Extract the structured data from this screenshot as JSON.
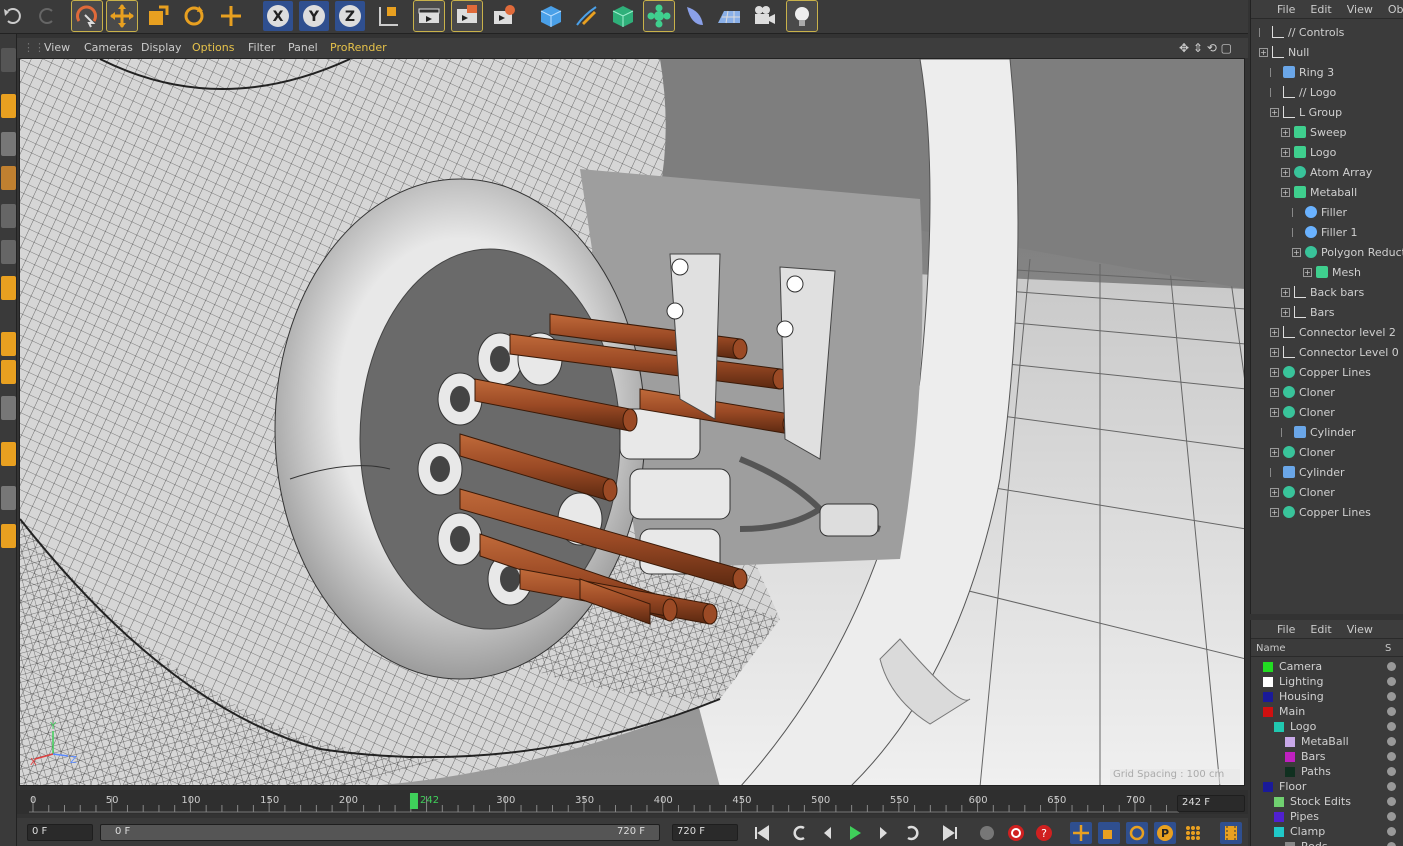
{
  "viewport_menu": [
    "View",
    "Cameras",
    "Display",
    "Options",
    "Filter",
    "Panel",
    "ProRender"
  ],
  "viewport_active_menu": "Options",
  "grid_spacing": "Grid Spacing : 100 cm",
  "axis": {
    "x": "X",
    "y": "Y",
    "z": "Z"
  },
  "toolbar_icons": [
    "undo-icon",
    "redo-icon",
    "live-selection-icon",
    "move-icon",
    "scale-icon",
    "rotate-icon",
    "move-icon",
    "x-axis-icon",
    "y-axis-icon",
    "z-axis-icon",
    "coordinate-system-icon",
    "render-view-icon",
    "render-picture-viewer-icon",
    "render-settings-icon",
    "cube-icon",
    "pen-icon",
    "subdivision-icon",
    "cloner-icon",
    "deformer-icon",
    "floor-icon",
    "camera-icon",
    "light-icon"
  ],
  "axis_labels": [
    "X",
    "Y",
    "Z"
  ],
  "object_panel": {
    "menu": [
      "File",
      "Edit",
      "View",
      "Obje"
    ],
    "items": [
      {
        "label": "// Controls",
        "icon": "null",
        "indent": 0,
        "exp": false
      },
      {
        "label": "Null",
        "icon": "null",
        "indent": 0,
        "exp": true
      },
      {
        "label": "Ring 3",
        "icon": "blue",
        "indent": 1,
        "exp": false
      },
      {
        "label": "// Logo",
        "icon": "null",
        "indent": 1,
        "exp": false
      },
      {
        "label": "L Group",
        "icon": "null",
        "indent": 1,
        "exp": true
      },
      {
        "label": "Sweep",
        "icon": "green",
        "indent": 2,
        "exp": true
      },
      {
        "label": "Logo",
        "icon": "green",
        "indent": 2,
        "exp": true
      },
      {
        "label": "Atom Array",
        "icon": "teal",
        "indent": 2,
        "exp": true
      },
      {
        "label": "Metaball",
        "icon": "green",
        "indent": 2,
        "exp": true
      },
      {
        "label": "Filler",
        "icon": "sphere",
        "indent": 3,
        "exp": false
      },
      {
        "label": "Filler 1",
        "icon": "sphere",
        "indent": 3,
        "exp": false
      },
      {
        "label": "Polygon Reducti",
        "icon": "teal",
        "indent": 3,
        "exp": true
      },
      {
        "label": "Mesh",
        "icon": "green",
        "indent": 4,
        "exp": true
      },
      {
        "label": "Back bars",
        "icon": "null",
        "indent": 2,
        "exp": true
      },
      {
        "label": "Bars",
        "icon": "null",
        "indent": 2,
        "exp": true
      },
      {
        "label": "Connector level 2",
        "icon": "null",
        "indent": 1,
        "exp": true
      },
      {
        "label": "Connector Level 0",
        "icon": "null",
        "indent": 1,
        "exp": true
      },
      {
        "label": "Copper Lines",
        "icon": "teal",
        "indent": 1,
        "exp": true
      },
      {
        "label": "Cloner",
        "icon": "teal",
        "indent": 1,
        "exp": true
      },
      {
        "label": "Cloner",
        "icon": "teal",
        "indent": 1,
        "exp": true
      },
      {
        "label": "Cylinder",
        "icon": "blue",
        "indent": 2,
        "exp": false
      },
      {
        "label": "Cloner",
        "icon": "teal",
        "indent": 1,
        "exp": true
      },
      {
        "label": "Cylinder",
        "icon": "blue",
        "indent": 1,
        "exp": false
      },
      {
        "label": "Cloner",
        "icon": "teal",
        "indent": 1,
        "exp": true
      },
      {
        "label": "Copper Lines",
        "icon": "teal",
        "indent": 1,
        "exp": true
      }
    ]
  },
  "layer_panel": {
    "menu": [
      "File",
      "Edit",
      "View"
    ],
    "header_name": "Name",
    "header_s": "S",
    "items": [
      {
        "label": "Camera",
        "color": "#22dd22",
        "indent": 0
      },
      {
        "label": "Lighting",
        "color": "#ffffff",
        "indent": 0
      },
      {
        "label": "Housing",
        "color": "#1a1a9a",
        "indent": 0
      },
      {
        "label": "Main",
        "color": "#d01010",
        "indent": 0
      },
      {
        "label": "Logo",
        "color": "#20c8b0",
        "indent": 1
      },
      {
        "label": "MetaBall",
        "color": "#c8a8e8",
        "indent": 2
      },
      {
        "label": "Bars",
        "color": "#c020c0",
        "indent": 2
      },
      {
        "label": "Paths",
        "color": "#103020",
        "indent": 2
      },
      {
        "label": "Floor",
        "color": "#1a1a9a",
        "indent": 0
      },
      {
        "label": "Stock Edits",
        "color": "#70d070",
        "indent": 1
      },
      {
        "label": "Pipes",
        "color": "#5020d0",
        "indent": 1
      },
      {
        "label": "Clamp",
        "color": "#20c8c8",
        "indent": 1
      },
      {
        "label": "Rods",
        "color": "#888888",
        "indent": 2
      }
    ]
  },
  "timeline": {
    "ticks": [
      "0",
      "50",
      "100",
      "150",
      "200",
      "242",
      "300",
      "350",
      "400",
      "450",
      "500",
      "550",
      "600",
      "650",
      "700"
    ],
    "tick_values": [
      0,
      50,
      100,
      150,
      200,
      242,
      300,
      350,
      400,
      450,
      500,
      550,
      600,
      650,
      700
    ],
    "current": 242,
    "current_label": "242",
    "end_field": "242 F"
  },
  "bottom": {
    "start_field": "0 F",
    "range_start": "0 F",
    "range_end": "720 F",
    "max_field": "720 F"
  },
  "colors": {
    "accent": "#e6c24a",
    "copper": "#9b4a25",
    "playhead": "#3fcf5a"
  }
}
